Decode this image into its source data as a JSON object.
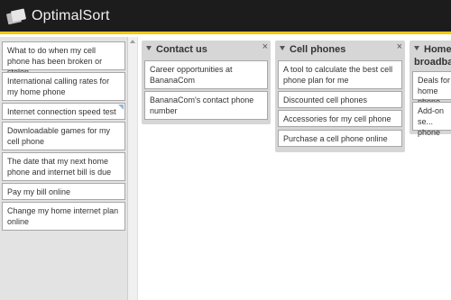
{
  "app": {
    "name": "OptimalSort"
  },
  "sidebar": {
    "cards": [
      {
        "label": "What to do when my cell phone has been broken or stolen"
      },
      {
        "label": "International calling rates for my home phone"
      },
      {
        "label": "Internet connection speed test"
      },
      {
        "label": "Downloadable games for my cell phone"
      },
      {
        "label": "The date that my next home phone and internet bill is due"
      },
      {
        "label": "Pay my bill online"
      },
      {
        "label": "Change my home internet plan online"
      }
    ]
  },
  "groups": [
    {
      "title": "Contact us",
      "close": "×",
      "cards": [
        {
          "label": "Career opportunities at BananaCom"
        },
        {
          "label": "BananaCom's contact phone number"
        }
      ]
    },
    {
      "title": "Cell phones",
      "close": "×",
      "cards": [
        {
          "label": "A tool to calculate the best cell phone plan for me"
        },
        {
          "label": "Discounted cell phones"
        },
        {
          "label": "Accessories for my cell phone"
        },
        {
          "label": "Purchase a cell phone online"
        }
      ]
    },
    {
      "title": "Home broadband",
      "cards": [
        {
          "label": "Deals for home phone bu..."
        },
        {
          "label": "Add-on se... phone"
        }
      ]
    }
  ]
}
